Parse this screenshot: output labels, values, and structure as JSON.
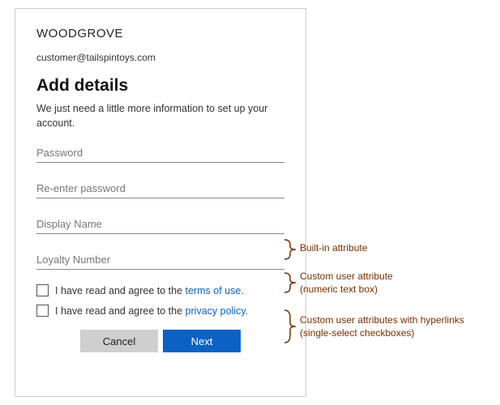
{
  "brand": "WOODGROVE",
  "email": "customer@tailspintoys.com",
  "heading": "Add details",
  "subtext": "We just need a little more information to set up your account.",
  "fields": {
    "password": "Password",
    "reenter": "Re-enter password",
    "display_name": "Display Name",
    "loyalty": "Loyalty Number"
  },
  "consents": {
    "prefix": "I have read and agree to the ",
    "terms_link": "terms of use",
    "privacy_link": "privacy policy",
    "period": "."
  },
  "buttons": {
    "cancel": "Cancel",
    "next": "Next"
  },
  "annotations": {
    "builtin": "Built-in attribute",
    "custom_numeric_l1": "Custom user attribute",
    "custom_numeric_l2": "(numeric text box)",
    "custom_links_l1": "Custom user attributes with hyperlinks",
    "custom_links_l2": "(single-select checkboxes)"
  }
}
